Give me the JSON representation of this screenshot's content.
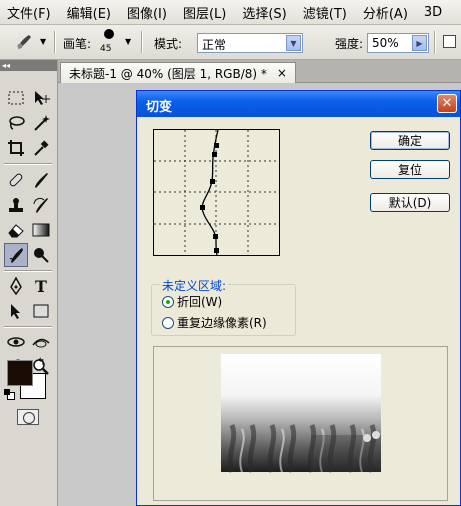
{
  "menubar": {
    "items": [
      "文件(F)",
      "编辑(E)",
      "图像(I)",
      "图层(L)",
      "选择(S)",
      "滤镜(T)",
      "分析(A)",
      "3D"
    ]
  },
  "options": {
    "brush_label": "画笔:",
    "brush_size": "45",
    "mode_label": "模式:",
    "mode_value": "正常",
    "strength_label": "强度:",
    "strength_value": "50%"
  },
  "document": {
    "tab_title": "未标题-1 @ 40% (图层 1, RGB/8) *",
    "close_glyph": "×"
  },
  "dialog": {
    "title": "切变",
    "close_glyph": "✕",
    "ok_label": "确定",
    "reset_label": "复位",
    "default_label": "默认(D)",
    "undefined_area_label": "未定义区域:",
    "option_wrap": "折回(W)",
    "option_repeat": "重复边缘像素(R)",
    "selected_option": "wrap"
  },
  "colors": {
    "foreground": "#1a0d05",
    "background": "#ffffff",
    "title_blue": "#0a5fe8"
  },
  "icons": [
    "brush-icon",
    "marquee-icon",
    "move-icon",
    "lasso-icon",
    "magic-wand-icon",
    "crop-icon",
    "eyedropper-icon",
    "healing-icon",
    "brush-tool-icon",
    "stamp-icon",
    "history-brush-icon",
    "eraser-icon",
    "gradient-icon",
    "smudge-icon",
    "dodge-icon",
    "pen-icon",
    "type-icon",
    "path-select-icon",
    "shape-icon",
    "3d-rotate-icon",
    "3d-orbit-icon",
    "hand-icon",
    "zoom-icon",
    "quick-mask-icon"
  ]
}
